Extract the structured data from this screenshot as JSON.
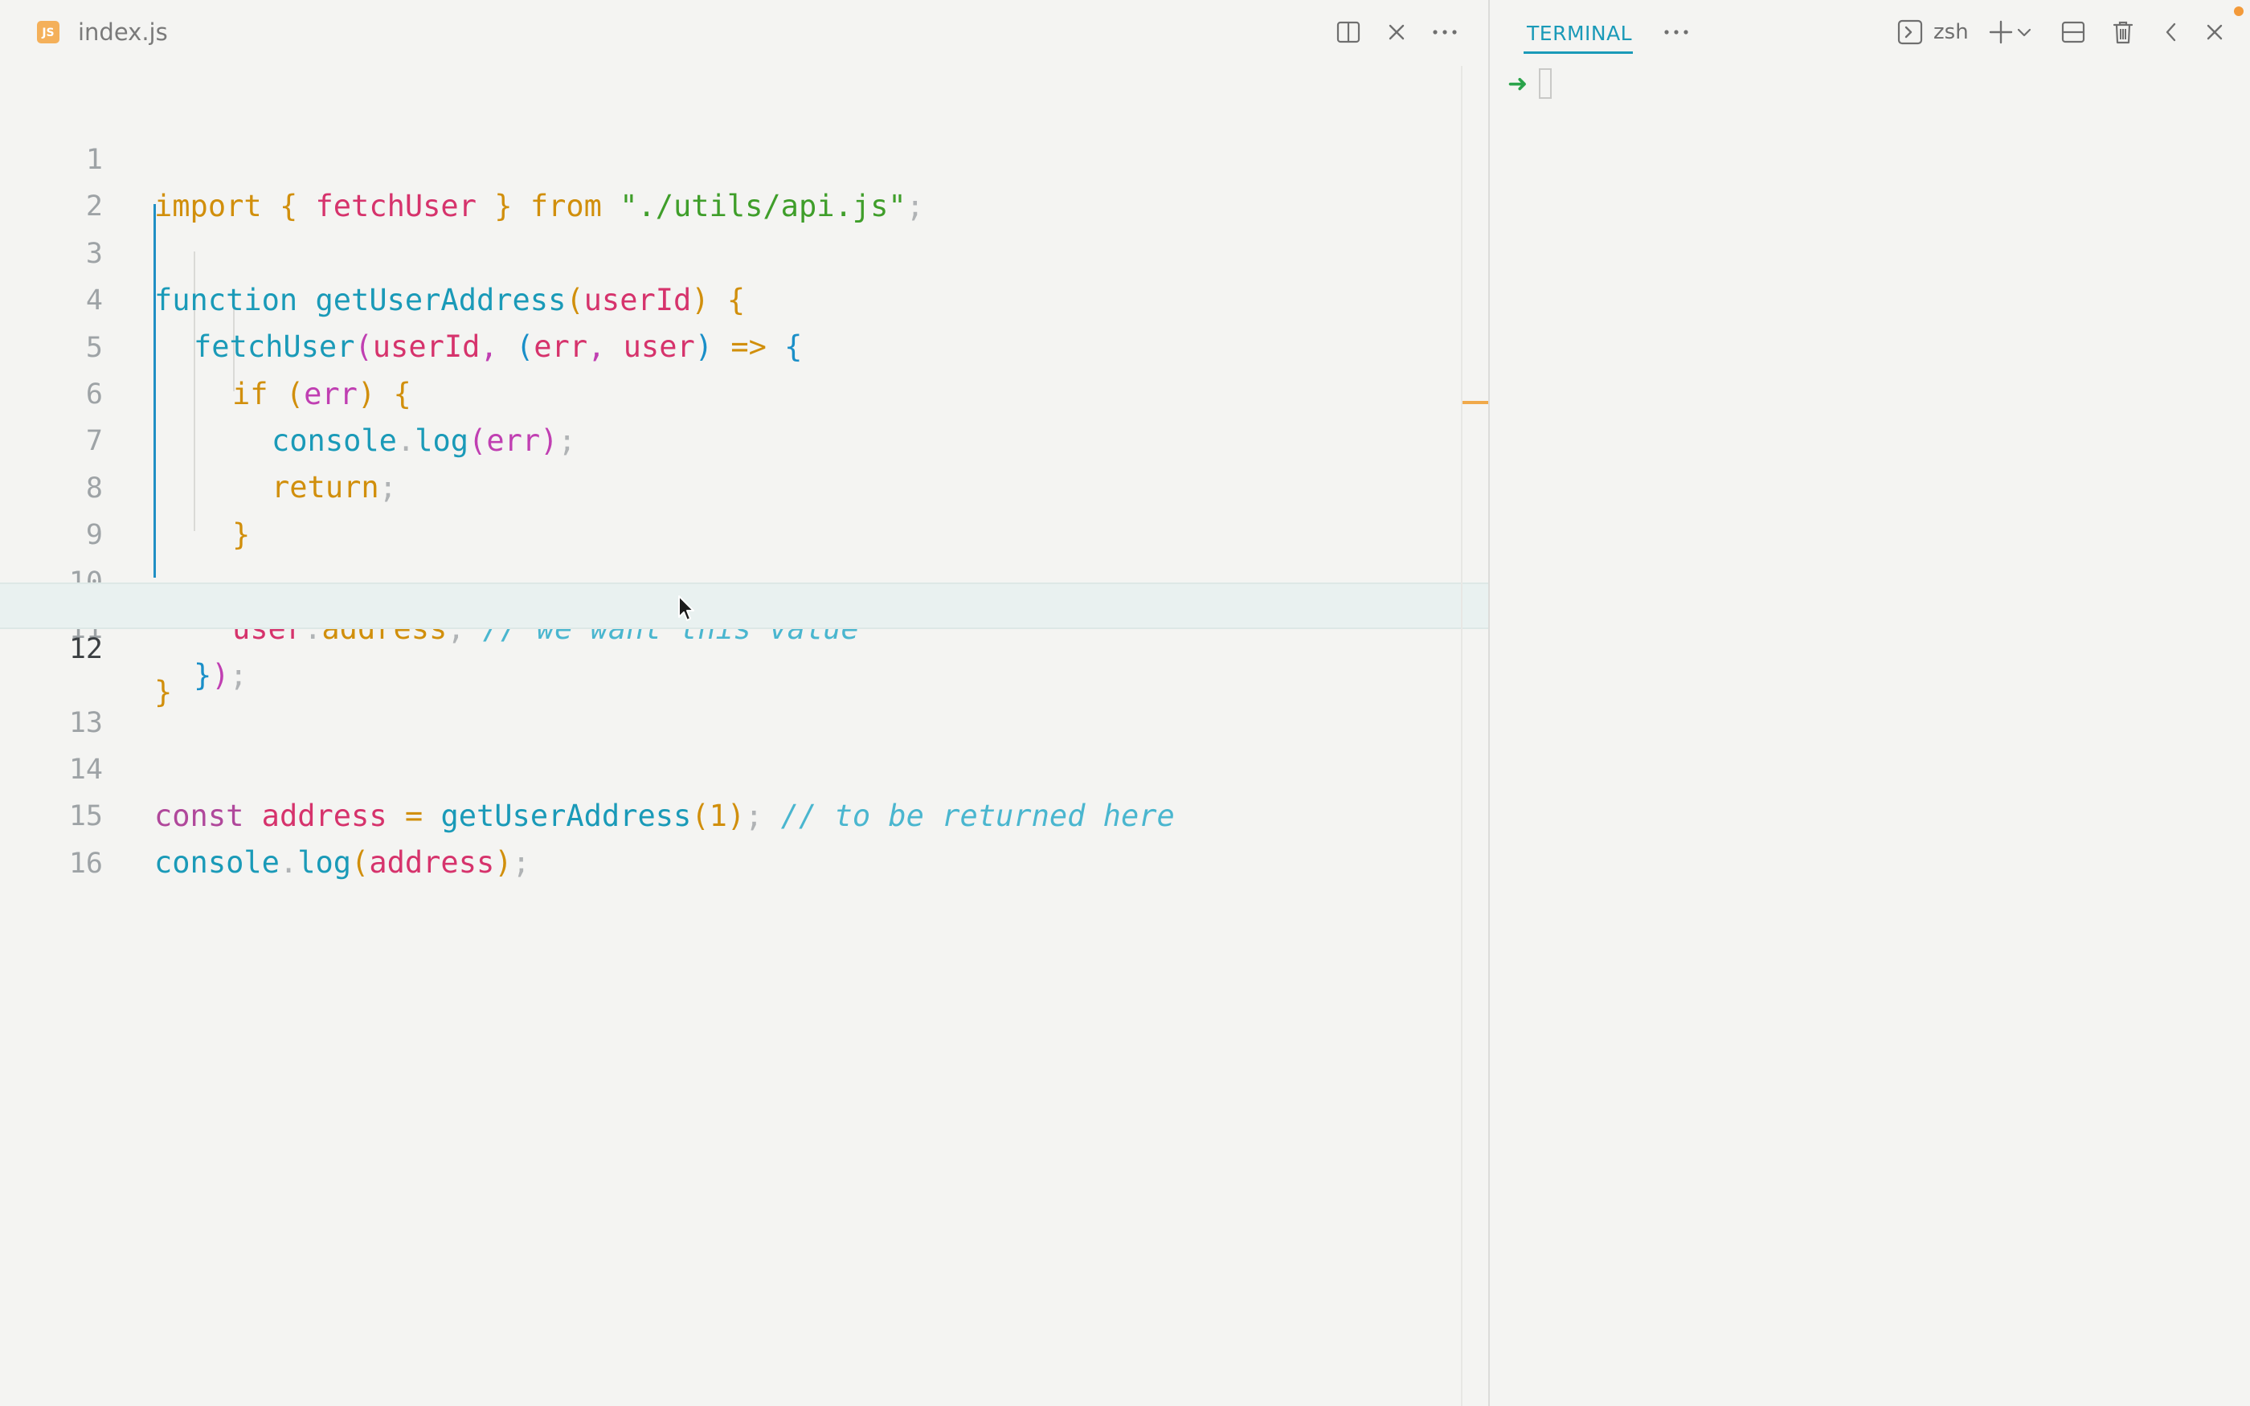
{
  "editor": {
    "tab": {
      "file_icon_label": "JS",
      "title": "index.js"
    },
    "lines": [
      {
        "n": "1"
      },
      {
        "n": "2"
      },
      {
        "n": "3"
      },
      {
        "n": "4"
      },
      {
        "n": "5"
      },
      {
        "n": "6"
      },
      {
        "n": "7"
      },
      {
        "n": "8"
      },
      {
        "n": "9"
      },
      {
        "n": "10"
      },
      {
        "n": "11"
      },
      {
        "n": "12"
      },
      {
        "n": "13"
      },
      {
        "n": "14"
      },
      {
        "n": "15"
      },
      {
        "n": "16"
      }
    ],
    "current_line": "12",
    "tokens": {
      "l1": [
        "import",
        " ",
        "{",
        " fetchUser ",
        "}",
        " from ",
        "\"./utils/api.js\"",
        ";"
      ],
      "l3": [
        "function",
        " ",
        "getUserAddress",
        "(",
        "userId",
        ")",
        " ",
        "{"
      ],
      "l4": [
        "fetchUser",
        "(",
        "userId",
        ", ",
        "(",
        "err",
        ", ",
        "user",
        ")",
        " => ",
        "{"
      ],
      "l5": [
        "if",
        " ",
        "(",
        "err",
        ")",
        " ",
        "{"
      ],
      "l6": [
        "console",
        ".",
        "log",
        "(",
        "err",
        ")",
        ";"
      ],
      "l7": [
        "return",
        ";"
      ],
      "l8": [
        "}"
      ],
      "l10": [
        "user",
        ".",
        "address",
        ";",
        " ",
        "// we want this value"
      ],
      "l11": [
        "}",
        ")",
        ";"
      ],
      "l12": [
        "}"
      ],
      "l14": [
        "const",
        " ",
        "address",
        " = ",
        "getUserAddress",
        "(",
        "1",
        ")",
        ";",
        " ",
        "// to be returned here"
      ],
      "l15": [
        "console",
        ".",
        "log",
        "(",
        "address",
        ")",
        ";"
      ]
    }
  },
  "terminal": {
    "tab_label": "TERMINAL",
    "shell_label": "zsh",
    "prompt_symbol": "➜"
  },
  "icons": {
    "split": "split-editor-icon",
    "close": "close-icon",
    "more": "more-icon",
    "shell": "terminal-shell-icon",
    "add": "add-icon",
    "chevron": "chevron-down-icon",
    "layout": "split-terminal-icon",
    "trash": "trash-icon",
    "back": "chevron-left-icon"
  },
  "colors": {
    "accent": "#1a9ab8",
    "keyword": "#d18f0c",
    "string": "#3f9e2a",
    "variable": "#d6336c",
    "comment": "#4ab6cf"
  }
}
